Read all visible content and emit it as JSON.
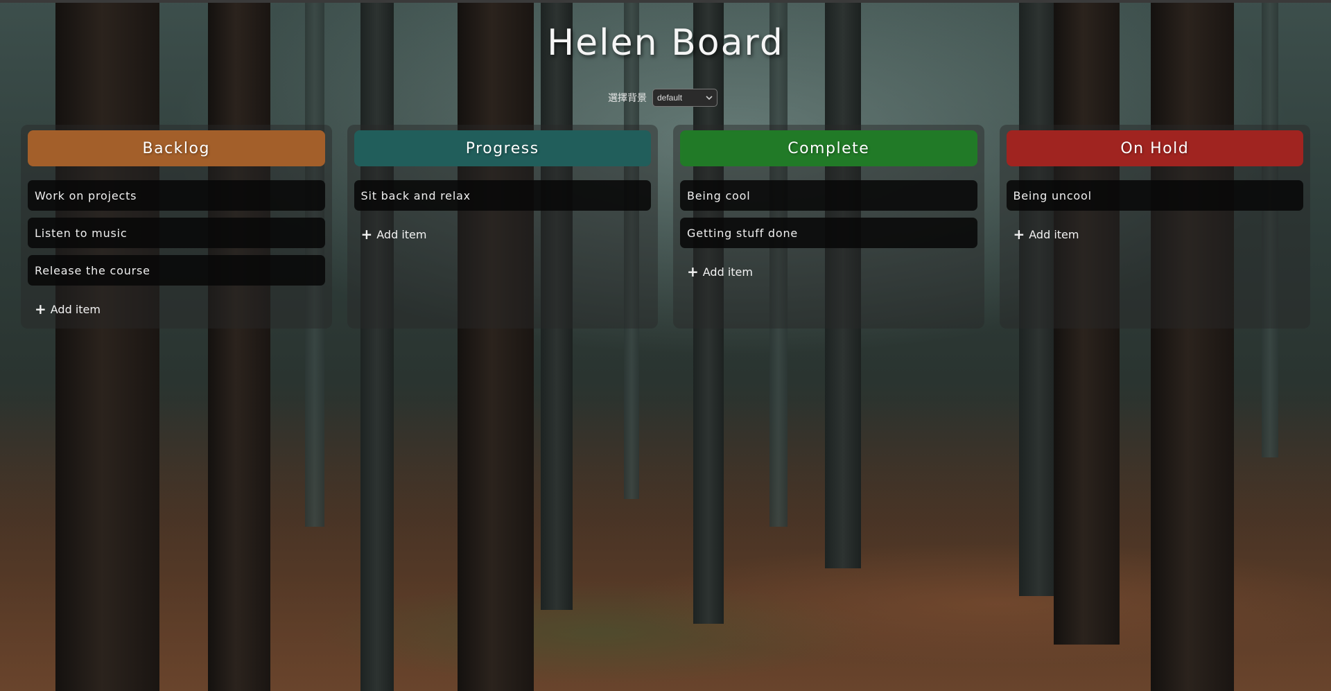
{
  "app": {
    "title": "Helen Board"
  },
  "background_picker": {
    "label": "選擇背景",
    "selected": "default"
  },
  "columns": [
    {
      "title": "Backlog",
      "color": "#a35f2a",
      "items": [
        "Work on projects",
        "Listen to music",
        "Release the course"
      ],
      "add_label": "Add item"
    },
    {
      "title": "Progress",
      "color": "#215e5b",
      "items": [
        "Sit back and relax"
      ],
      "add_label": "Add item"
    },
    {
      "title": "Complete",
      "color": "#217a27",
      "items": [
        "Being cool",
        "Getting stuff done"
      ],
      "add_label": "Add item"
    },
    {
      "title": "On Hold",
      "color": "#a02420",
      "items": [
        "Being uncool"
      ],
      "add_label": "Add item"
    }
  ]
}
